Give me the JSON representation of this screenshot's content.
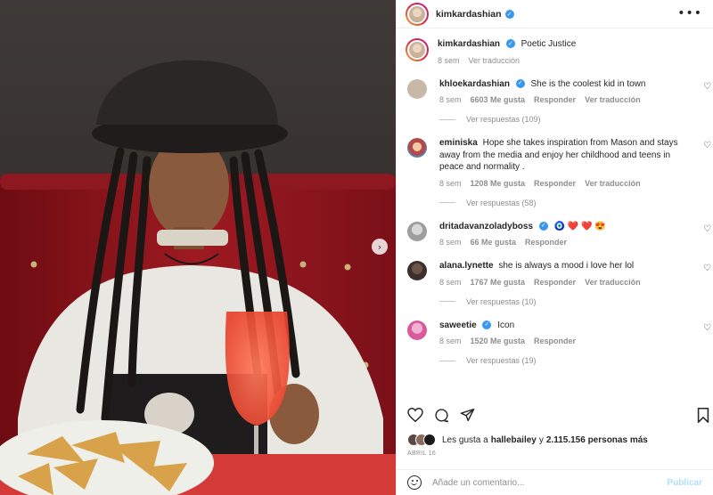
{
  "post": {
    "author": "kimkardashian",
    "caption": "Poetic Justice",
    "caption_time": "8 sem",
    "caption_translate": "Ver traducción"
  },
  "comments": [
    {
      "user": "khloekardashian",
      "verified": true,
      "text": "She is the coolest kid in town",
      "time": "8 sem",
      "likes": "6603 Me gusta",
      "reply": "Responder",
      "translate": "Ver traducción",
      "replies": "Ver respuestas (109)",
      "avatar_color": "#c7b8a8"
    },
    {
      "user": "eminiska",
      "verified": false,
      "text": "Hope she takes inspiration from Mason and stays away from the media and enjoy her childhood and teens in peace and normality .",
      "time": "8 sem",
      "likes": "1208 Me gusta",
      "reply": "Responder",
      "translate": "Ver traducción",
      "replies": "Ver respuestas (58)",
      "avatar_color": "#b24a4a"
    },
    {
      "user": "dritadavanzoladyboss",
      "verified": true,
      "text": "🧿 ❤️ ❤️ 😍",
      "time": "8 sem",
      "likes": "66 Me gusta",
      "reply": "Responder",
      "translate": "",
      "replies": "",
      "avatar_color": "#9e9e9e"
    },
    {
      "user": "alana.lynette",
      "verified": false,
      "text": "she is always a mood i love her lol",
      "time": "8 sem",
      "likes": "1767 Me gusta",
      "reply": "Responder",
      "translate": "Ver traducción",
      "replies": "Ver respuestas (10)",
      "avatar_color": "#3b2f2f"
    },
    {
      "user": "saweetie",
      "verified": true,
      "text": "Icon",
      "time": "8 sem",
      "likes": "1520 Me gusta",
      "reply": "Responder",
      "translate": "",
      "replies": "Ver respuestas (19)",
      "avatar_color": "#d85a9c"
    }
  ],
  "likes": {
    "prefix": "Les gusta a",
    "user": "hallebailey",
    "connector": "y",
    "count": "2.115.156 personas más"
  },
  "date": "ABRIL 16",
  "add_comment": {
    "placeholder": "Añade un comentario...",
    "post_label": "Publicar"
  },
  "icons": {
    "more": "more-options-icon",
    "like": "heart-icon",
    "comment": "comment-icon",
    "share": "share-icon",
    "save": "bookmark-icon",
    "emoji": "emoji-icon",
    "next": "chevron-right-icon"
  },
  "colors": {
    "link_blue": "#3897f0",
    "muted": "#8e8e8e",
    "text": "#262626"
  }
}
